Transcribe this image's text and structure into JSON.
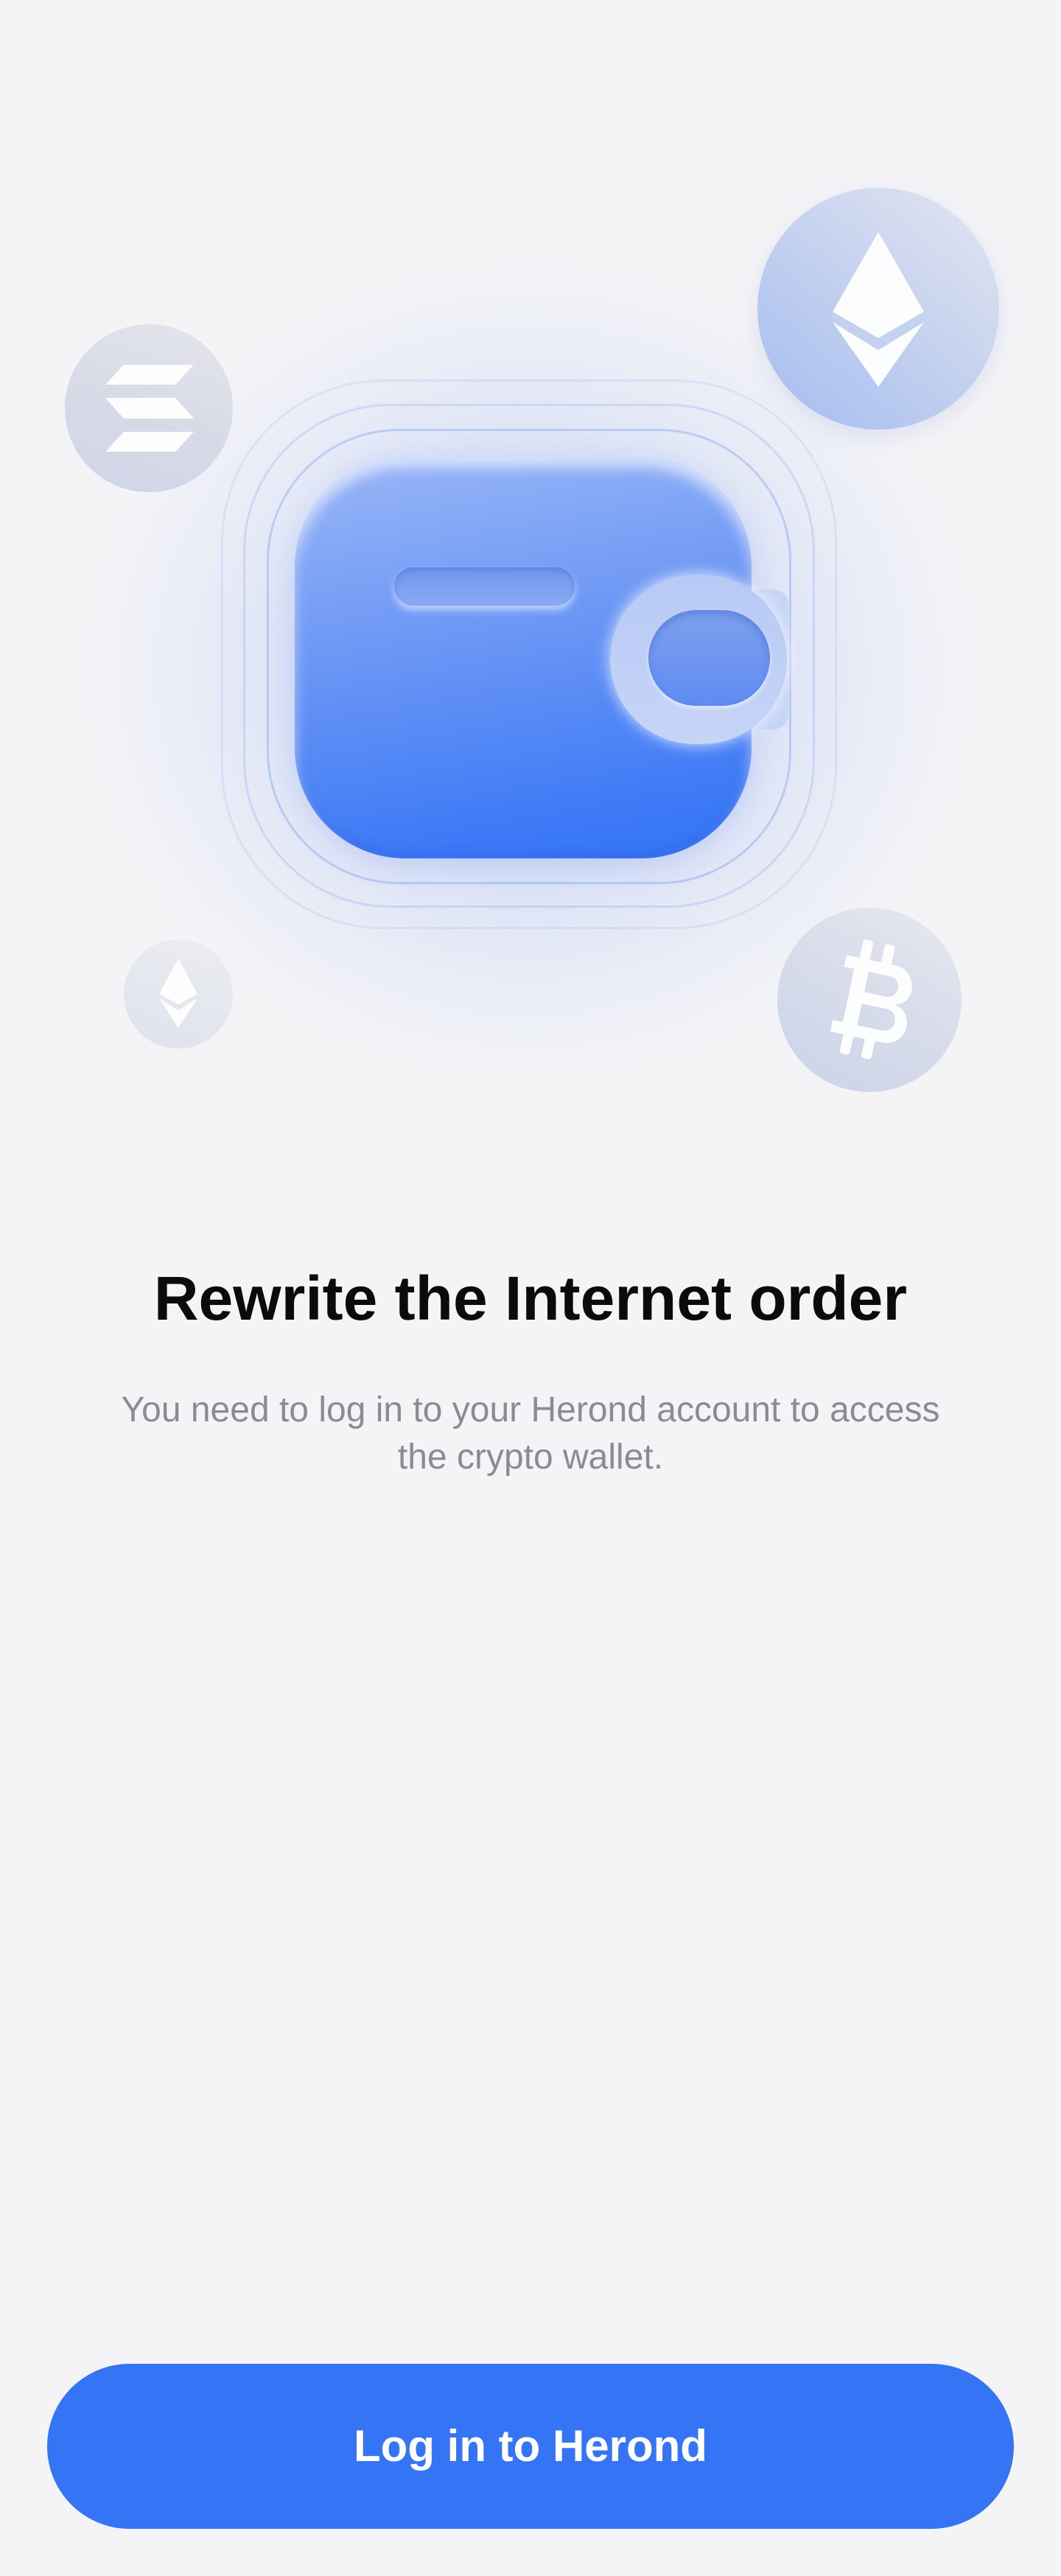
{
  "hero": {
    "title": "Rewrite the Internet order",
    "subtitle": "You need to log in to your Herond account to access the crypto wallet."
  },
  "illustration": {
    "main_icon": "wallet-icon",
    "coins": [
      "ethereum-icon",
      "solana-icon",
      "ethereum-icon",
      "bitcoin-icon"
    ]
  },
  "actions": {
    "login_label": "Log in to Herond"
  },
  "colors": {
    "background": "#f4f4f7",
    "accent": "#3574f5",
    "title": "#0b0b0d",
    "subtitle": "#8a8b93",
    "button_text": "#ffffff"
  }
}
